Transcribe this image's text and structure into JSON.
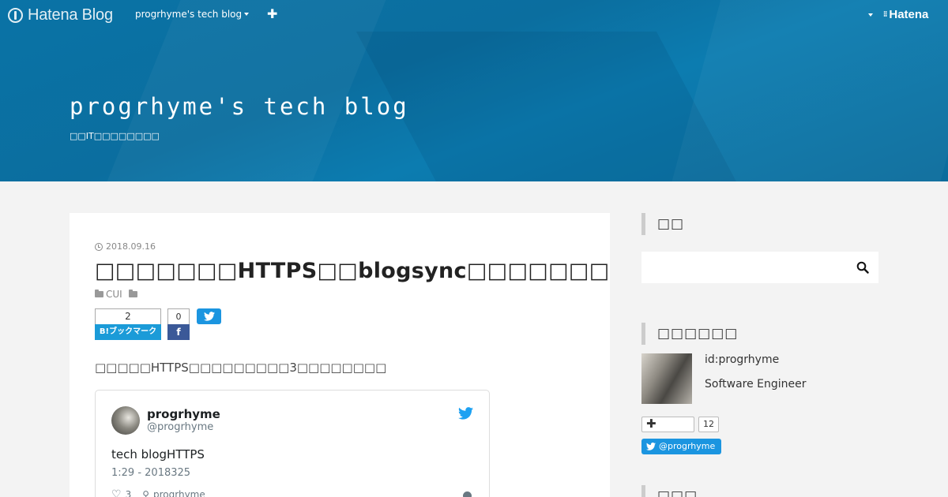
{
  "globalbar": {
    "logo_text": "Hatena Blog",
    "blog_menu_label": "progrhyme's tech blog",
    "add_icon": "plus-icon",
    "hatena_label": "Hatena"
  },
  "header": {
    "blog_title": "progrhyme's tech blog",
    "blog_description": "□□IT□□□□□□□□"
  },
  "entry": {
    "date": "2018.09.16",
    "title": "□□□□□□□HTTPS□□blogsync□□□□□□□",
    "categories": [
      "CUI",
      ""
    ],
    "hatebu_count": "2",
    "hatebu_label": "B!ブックマーク",
    "facebook_count": "0",
    "facebook_label": "f",
    "lead": "□□□□□HTTPS□□□□□□□□□3□□□□□□□□",
    "tweet": {
      "name": "progrhyme",
      "handle": "@progrhyme",
      "text": "tech blogHTTPS",
      "time": "1:29 - 2018325",
      "likes": "3",
      "author": "progrhyme"
    }
  },
  "sidebar": {
    "search_title": "□□",
    "search_value": "",
    "profile_title": "□□□□□□",
    "profile_id": "id:progrhyme",
    "profile_desc": "Software Engineer",
    "follow_count": "12",
    "twitter_follow_label": "@progrhyme",
    "next_title": "□□□"
  },
  "colors": {
    "header_blue": "#0a73a6",
    "hatebu_blue": "#1b9bd8",
    "facebook_blue": "#3b5998",
    "twitter_blue": "#1b95e0"
  }
}
